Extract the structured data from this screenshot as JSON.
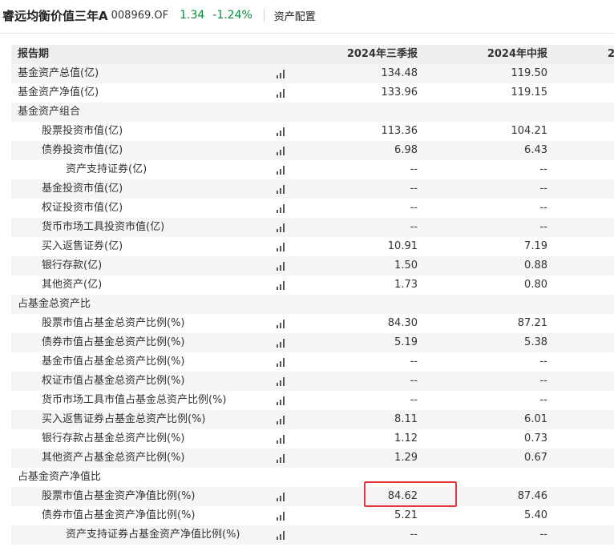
{
  "header": {
    "fund_name": "睿远均衡价值三年A",
    "fund_code": "008969.OF",
    "nav": "1.34",
    "change": "-1.24%",
    "tab": "资产配置"
  },
  "table": {
    "columns": [
      "报告期",
      "2024年三季报",
      "2024年中报",
      "2"
    ],
    "rows": [
      {
        "label": "基金资产总值(亿)",
        "level": 0,
        "chart": true,
        "v1": "134.48",
        "v2": "119.50"
      },
      {
        "label": "基金资产净值(亿)",
        "level": 0,
        "chart": true,
        "v1": "133.96",
        "v2": "119.15"
      },
      {
        "label": "基金资产组合",
        "level": 0,
        "chart": false,
        "v1": "",
        "v2": ""
      },
      {
        "label": "股票投资市值(亿)",
        "level": 1,
        "chart": true,
        "v1": "113.36",
        "v2": "104.21"
      },
      {
        "label": "债券投资市值(亿)",
        "level": 1,
        "chart": true,
        "v1": "6.98",
        "v2": "6.43"
      },
      {
        "label": "资产支持证券(亿)",
        "level": 2,
        "chart": true,
        "v1": "--",
        "v2": "--"
      },
      {
        "label": "基金投资市值(亿)",
        "level": 1,
        "chart": true,
        "v1": "--",
        "v2": "--"
      },
      {
        "label": "权证投资市值(亿)",
        "level": 1,
        "chart": true,
        "v1": "--",
        "v2": "--"
      },
      {
        "label": "货币市场工具投资市值(亿)",
        "level": 1,
        "chart": true,
        "v1": "--",
        "v2": "--"
      },
      {
        "label": "买入返售证券(亿)",
        "level": 1,
        "chart": true,
        "v1": "10.91",
        "v2": "7.19"
      },
      {
        "label": "银行存款(亿)",
        "level": 1,
        "chart": true,
        "v1": "1.50",
        "v2": "0.88"
      },
      {
        "label": "其他资产(亿)",
        "level": 1,
        "chart": true,
        "v1": "1.73",
        "v2": "0.80"
      },
      {
        "label": "占基金总资产比",
        "level": 0,
        "chart": false,
        "v1": "",
        "v2": ""
      },
      {
        "label": "股票市值占基金总资产比例(%)",
        "level": 1,
        "chart": true,
        "v1": "84.30",
        "v2": "87.21"
      },
      {
        "label": "债券市值占基金总资产比例(%)",
        "level": 1,
        "chart": true,
        "v1": "5.19",
        "v2": "5.38"
      },
      {
        "label": "基金市值占基金总资产比例(%)",
        "level": 1,
        "chart": true,
        "v1": "--",
        "v2": "--"
      },
      {
        "label": "权证市值占基金总资产比例(%)",
        "level": 1,
        "chart": true,
        "v1": "--",
        "v2": "--"
      },
      {
        "label": "货币市场工具市值占基金总资产比例(%)",
        "level": 1,
        "chart": true,
        "v1": "--",
        "v2": "--"
      },
      {
        "label": "买入返售证券占基金总资产比例(%)",
        "level": 1,
        "chart": true,
        "v1": "8.11",
        "v2": "6.01"
      },
      {
        "label": "银行存款占基金总资产比例(%)",
        "level": 1,
        "chart": true,
        "v1": "1.12",
        "v2": "0.73"
      },
      {
        "label": "其他资产占基金总资产比例(%)",
        "level": 1,
        "chart": true,
        "v1": "1.29",
        "v2": "0.67"
      },
      {
        "label": "占基金资产净值比",
        "level": 0,
        "chart": false,
        "v1": "",
        "v2": ""
      },
      {
        "label": "股票市值占基金资产净值比例(%)",
        "level": 1,
        "chart": true,
        "v1": "84.62",
        "v2": "87.46"
      },
      {
        "label": "债券市值占基金资产净值比例(%)",
        "level": 1,
        "chart": true,
        "v1": "5.21",
        "v2": "5.40"
      },
      {
        "label": "资产支持证券占基金资产净值比例(%)",
        "level": 2,
        "chart": true,
        "v1": "--",
        "v2": "--"
      }
    ]
  },
  "colors": {
    "change_green": "#0d8a3a",
    "highlight_red": "#e5383b",
    "stripe": "#f5f5f5",
    "header_bg": "#efefef"
  },
  "icons": {
    "chart_icon": "bar-chart-icon"
  }
}
